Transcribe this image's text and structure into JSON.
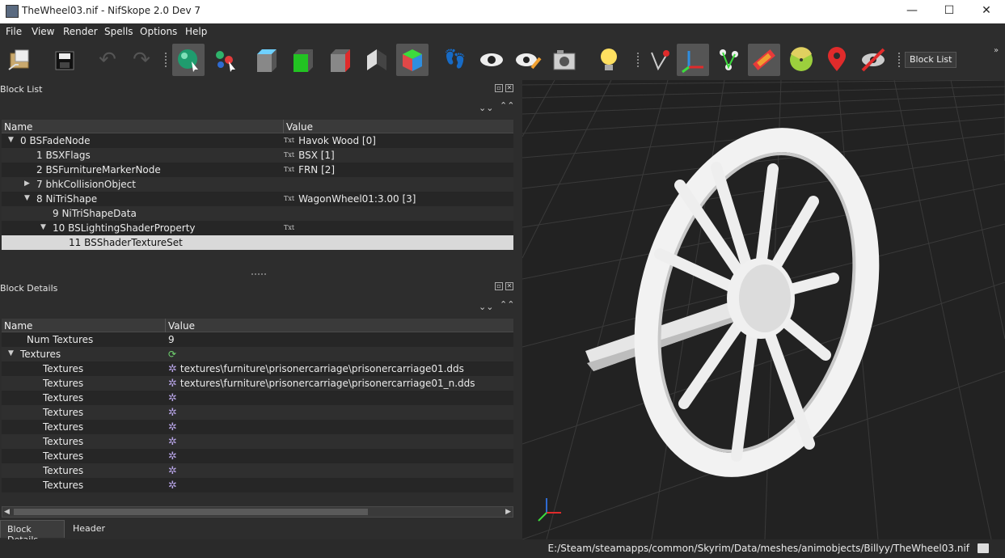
{
  "window": {
    "title": "TheWheel03.nif - NifSkope 2.0 Dev 7",
    "minimize": "—",
    "maximize": "☐",
    "close": "✕"
  },
  "menu": [
    "File",
    "View",
    "Render",
    "Spells",
    "Options",
    "Help"
  ],
  "toolbar": {
    "block_list_button": "Block List",
    "icons": [
      "load-icon",
      "save-icon",
      "undo-icon",
      "redo-icon",
      "select-object-icon",
      "select-vertex-icon",
      "view-front-icon",
      "view-top-icon",
      "view-side-icon",
      "view-perspective-icon",
      "view-3d-icon",
      "walk-mode-icon",
      "show-hidden-icon",
      "show-nodes-icon",
      "screenshot-icon",
      "lighting-icon",
      "show-axes-icon",
      "show-constraints-icon",
      "show-markers-icon",
      "show-havok-icon",
      "show-furniture-icon",
      "show-culling-icon",
      "show-vertex-colors-icon",
      "show-hidden-off-icon"
    ]
  },
  "block_list": {
    "title": "Block List",
    "columns": [
      "Name",
      "Value"
    ],
    "rows": [
      {
        "name": "0 BSFadeNode",
        "value": "Havok Wood [0]",
        "txt": "Txt",
        "expander": "▼",
        "indent": 0
      },
      {
        "name": "1 BSXFlags",
        "value": "BSX [1]",
        "txt": "Txt",
        "expander": "",
        "indent": 1
      },
      {
        "name": "2 BSFurnitureMarkerNode",
        "value": "FRN [2]",
        "txt": "Txt",
        "expander": "",
        "indent": 1
      },
      {
        "name": "7 bhkCollisionObject",
        "value": "",
        "txt": "",
        "expander": "▶",
        "indent": 1
      },
      {
        "name": "8 NiTriShape",
        "value": "WagonWheel01:3.00 [3]",
        "txt": "Txt",
        "expander": "▼",
        "indent": 1
      },
      {
        "name": "9 NiTriShapeData",
        "value": "",
        "txt": "",
        "expander": "",
        "indent": 2
      },
      {
        "name": "10 BSLightingShaderProperty",
        "value": "",
        "txt": "Txt",
        "expander": "▼",
        "indent": 2
      },
      {
        "name": "11 BSShaderTextureSet",
        "value": "",
        "txt": "",
        "expander": "",
        "indent": 3,
        "selected": true
      }
    ]
  },
  "block_details": {
    "title": "Block Details",
    "columns": [
      "Name",
      "Value"
    ],
    "rows": [
      {
        "name": "Num Textures",
        "value": "9",
        "icon": "",
        "expander": "",
        "indent": 1
      },
      {
        "name": "Textures",
        "value": "",
        "icon": "refresh",
        "expander": "▼",
        "indent": 0
      },
      {
        "name": "Textures",
        "value": "textures\\furniture\\prisonercarriage\\prisonercarriage01.dds",
        "icon": "gear",
        "expander": "",
        "indent": 2
      },
      {
        "name": "Textures",
        "value": "textures\\furniture\\prisonercarriage\\prisonercarriage01_n.dds",
        "icon": "gear",
        "expander": "",
        "indent": 2
      },
      {
        "name": "Textures",
        "value": "",
        "icon": "gear",
        "expander": "",
        "indent": 2
      },
      {
        "name": "Textures",
        "value": "",
        "icon": "gear",
        "expander": "",
        "indent": 2
      },
      {
        "name": "Textures",
        "value": "",
        "icon": "gear",
        "expander": "",
        "indent": 2
      },
      {
        "name": "Textures",
        "value": "",
        "icon": "gear",
        "expander": "",
        "indent": 2
      },
      {
        "name": "Textures",
        "value": "",
        "icon": "gear",
        "expander": "",
        "indent": 2
      },
      {
        "name": "Textures",
        "value": "",
        "icon": "gear",
        "expander": "",
        "indent": 2
      },
      {
        "name": "Textures",
        "value": "",
        "icon": "gear",
        "expander": "",
        "indent": 2
      }
    ]
  },
  "tabs": [
    "Block Details",
    "Header"
  ],
  "status": {
    "path": "E:/Steam/steamapps/common/Skyrim/Data/meshes/animobjects/Billyy/TheWheel03.nif"
  }
}
